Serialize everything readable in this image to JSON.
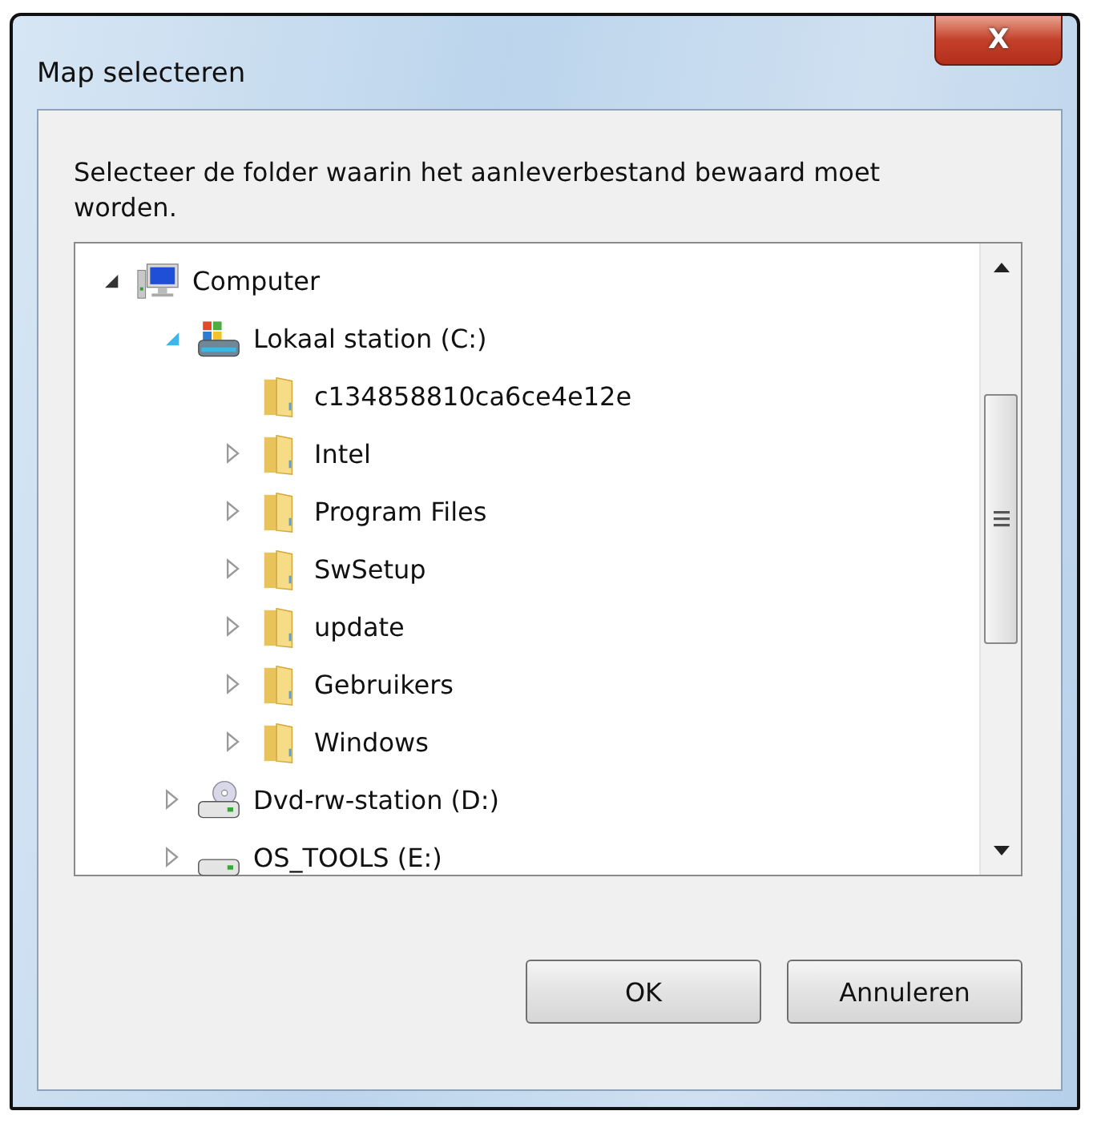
{
  "window": {
    "title": "Map selecteren",
    "close": "X"
  },
  "instruction": "Selecteer de folder waarin het aanleverbestand bewaard moet worden.",
  "tree": [
    {
      "label": "Computer",
      "kind": "computer",
      "expandable": true,
      "expanded": true,
      "children": [
        {
          "label": "Lokaal station (C:)",
          "kind": "system-drive",
          "expandable": true,
          "expanded": true,
          "children": [
            {
              "label": "c134858810ca6ce4e12e",
              "kind": "folder",
              "expandable": false
            },
            {
              "label": "Intel",
              "kind": "folder",
              "expandable": true,
              "expanded": false
            },
            {
              "label": "Program Files",
              "kind": "folder",
              "expandable": true,
              "expanded": false
            },
            {
              "label": "SwSetup",
              "kind": "folder",
              "expandable": true,
              "expanded": false
            },
            {
              "label": "update",
              "kind": "folder",
              "expandable": true,
              "expanded": false
            },
            {
              "label": "Gebruikers",
              "kind": "folder",
              "expandable": true,
              "expanded": false
            },
            {
              "label": "Windows",
              "kind": "folder",
              "expandable": true,
              "expanded": false
            }
          ]
        },
        {
          "label": "Dvd-rw-station (D:)",
          "kind": "dvd-drive",
          "expandable": true,
          "expanded": false
        },
        {
          "label": "OS_TOOLS (E:)",
          "kind": "drive",
          "expandable": true,
          "expanded": false
        }
      ]
    }
  ],
  "buttons": [
    "OK",
    "Annuleren"
  ]
}
